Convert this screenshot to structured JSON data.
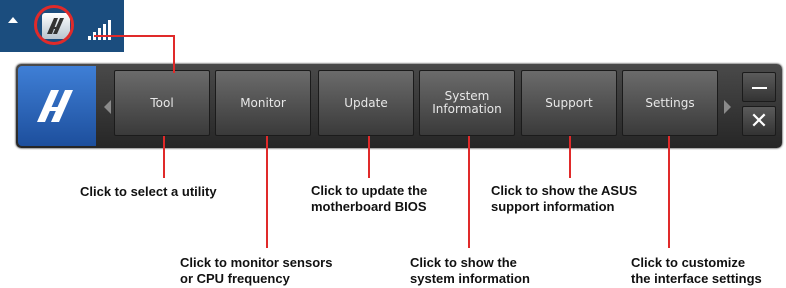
{
  "tray": {
    "up_arrow_icon": "chevron-up-icon",
    "ai_suite_icon": "ai-suite-tray-icon",
    "signal_icon": "signal-bars-icon"
  },
  "toolbar": {
    "logo_icon": "ai-suite-logo-icon",
    "tabs": [
      {
        "label": "Tool"
      },
      {
        "label": "Monitor"
      },
      {
        "label": "Update"
      },
      {
        "label": "System\nInformation"
      },
      {
        "label": "Support"
      },
      {
        "label": "Settings"
      }
    ],
    "minimize_icon": "minimize-icon",
    "close_label": "✕"
  },
  "callouts": {
    "tool": "Click to select a utility",
    "update": "Click to update the\nmotherboard BIOS",
    "support": "Click to show the ASUS\nsupport information",
    "monitor": "Click to monitor sensors\nor CPU frequency",
    "system_info": "Click to show the\nsystem information",
    "settings": "Click to customize\nthe interface settings"
  },
  "colors": {
    "callout_line": "#e02a2a",
    "tray_bg": "#1b4d7e",
    "logo_bg": "#2b63b8"
  }
}
